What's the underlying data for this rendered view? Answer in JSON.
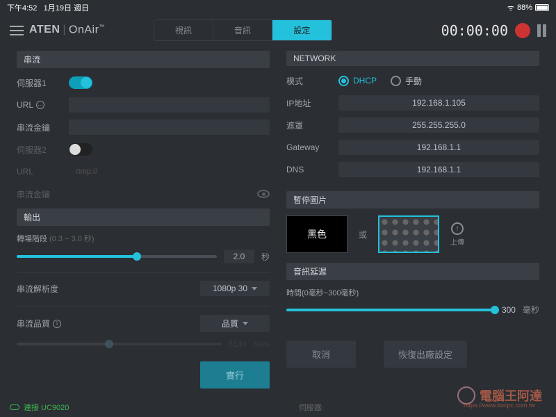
{
  "statusbar": {
    "time": "下午4:52",
    "date": "1月19日 週日",
    "battery": "88%"
  },
  "brand": {
    "main": "ATEN",
    "sub": "OnAir",
    "tm": "™"
  },
  "tabs": {
    "video": "視訊",
    "audio": "音訊",
    "settings": "設定"
  },
  "timer": "00:00:00",
  "stream": {
    "title": "串流",
    "server1": "伺服器1",
    "url": "URL",
    "key": "串流金鑰",
    "server2": "伺服器2",
    "url2": "URL",
    "url2_plch": "rtmp://",
    "key2": "串流金鑰"
  },
  "output": {
    "title": "輸出",
    "transition": "轉場階段",
    "transition_hint": "(0.3 ~ 3.0 秒)",
    "transition_val": "2.0",
    "sec": "秒",
    "resolution": "串流解析度",
    "resolution_val": "1080p 30",
    "quality": "串流品質",
    "quality_val": "品質",
    "bitrate_val": "6144",
    "bitrate_unit": "Kbps"
  },
  "network": {
    "title": "NETWORK",
    "mode": "模式",
    "dhcp": "DHCP",
    "manual": "手動",
    "ip_label": "IP地址",
    "ip": "192.168.1.105",
    "mask_label": "遮罩",
    "mask": "255.255.255.0",
    "gw_label": "Gateway",
    "gw": "192.168.1.1",
    "dns_label": "DNS",
    "dns": "192.168.1.1"
  },
  "pause": {
    "title": "暫停圖片",
    "black": "黑色",
    "or": "或",
    "upload": "上傳"
  },
  "delay": {
    "title": "音訊延遲",
    "label": "時間(0毫秒~300毫秒)",
    "val": "300",
    "unit": "毫秒"
  },
  "buttons": {
    "apply": "實行",
    "cancel": "取消",
    "reset": "恢復出廠設定"
  },
  "footer": {
    "connected": "連接 UC9020",
    "server": "伺服器:"
  },
  "watermark": {
    "text": "電腦王阿達",
    "url": "https://www.kocpc.com.tw"
  }
}
